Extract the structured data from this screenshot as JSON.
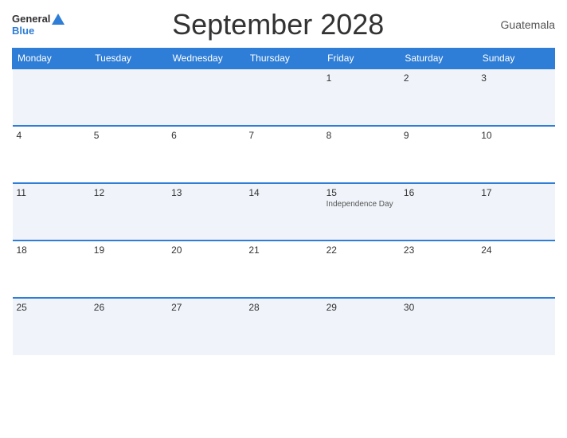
{
  "header": {
    "title": "September 2028",
    "country": "Guatemala",
    "logo_general": "General",
    "logo_blue": "Blue"
  },
  "weekdays": [
    "Monday",
    "Tuesday",
    "Wednesday",
    "Thursday",
    "Friday",
    "Saturday",
    "Sunday"
  ],
  "weeks": [
    [
      {
        "day": "",
        "holiday": ""
      },
      {
        "day": "",
        "holiday": ""
      },
      {
        "day": "",
        "holiday": ""
      },
      {
        "day": "",
        "holiday": ""
      },
      {
        "day": "1",
        "holiday": ""
      },
      {
        "day": "2",
        "holiday": ""
      },
      {
        "day": "3",
        "holiday": ""
      }
    ],
    [
      {
        "day": "4",
        "holiday": ""
      },
      {
        "day": "5",
        "holiday": ""
      },
      {
        "day": "6",
        "holiday": ""
      },
      {
        "day": "7",
        "holiday": ""
      },
      {
        "day": "8",
        "holiday": ""
      },
      {
        "day": "9",
        "holiday": ""
      },
      {
        "day": "10",
        "holiday": ""
      }
    ],
    [
      {
        "day": "11",
        "holiday": ""
      },
      {
        "day": "12",
        "holiday": ""
      },
      {
        "day": "13",
        "holiday": ""
      },
      {
        "day": "14",
        "holiday": ""
      },
      {
        "day": "15",
        "holiday": "Independence Day"
      },
      {
        "day": "16",
        "holiday": ""
      },
      {
        "day": "17",
        "holiday": ""
      }
    ],
    [
      {
        "day": "18",
        "holiday": ""
      },
      {
        "day": "19",
        "holiday": ""
      },
      {
        "day": "20",
        "holiday": ""
      },
      {
        "day": "21",
        "holiday": ""
      },
      {
        "day": "22",
        "holiday": ""
      },
      {
        "day": "23",
        "holiday": ""
      },
      {
        "day": "24",
        "holiday": ""
      }
    ],
    [
      {
        "day": "25",
        "holiday": ""
      },
      {
        "day": "26",
        "holiday": ""
      },
      {
        "day": "27",
        "holiday": ""
      },
      {
        "day": "28",
        "holiday": ""
      },
      {
        "day": "29",
        "holiday": ""
      },
      {
        "day": "30",
        "holiday": ""
      },
      {
        "day": "",
        "holiday": ""
      }
    ]
  ]
}
